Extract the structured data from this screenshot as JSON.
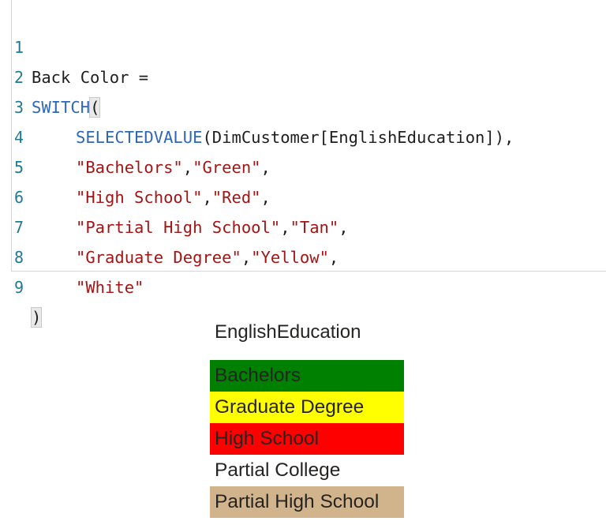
{
  "editor": {
    "lines": [
      {
        "no": "1",
        "text": "Back Color ="
      },
      {
        "no": "2",
        "kw": "SWITCH",
        "punct": "("
      },
      {
        "no": "3",
        "kw": "SELECTEDVALUE",
        "rest": "(DimCustomer[EnglishEducation]),"
      },
      {
        "no": "4",
        "s1": "\"Bachelors\"",
        "comma": ",",
        "s2": "\"Green\"",
        "end": ","
      },
      {
        "no": "5",
        "s1": "\"High School\"",
        "comma": ",",
        "s2": "\"Red\"",
        "end": ","
      },
      {
        "no": "6",
        "s1": "\"Partial High School\"",
        "comma": ",",
        "s2": "\"Tan\"",
        "end": ","
      },
      {
        "no": "7",
        "s1": "\"Graduate Degree\"",
        "comma": ",",
        "s2": "\"Yellow\"",
        "end": ","
      },
      {
        "no": "8",
        "s1": "\"White\""
      },
      {
        "no": "9",
        "punct": ")"
      }
    ]
  },
  "table": {
    "header": "EnglishEducation",
    "rows": [
      {
        "label": "Bachelors",
        "bg": "#008000"
      },
      {
        "label": "Graduate Degree",
        "bg": "#ffff00"
      },
      {
        "label": "High School",
        "bg": "#ff0000"
      },
      {
        "label": "Partial College",
        "bg": "#ffffff"
      },
      {
        "label": "Partial High School",
        "bg": "#d2b48c"
      }
    ]
  },
  "colors": {
    "keyword": "#2e67b8",
    "string": "#a31515",
    "line_number": "#237893"
  }
}
